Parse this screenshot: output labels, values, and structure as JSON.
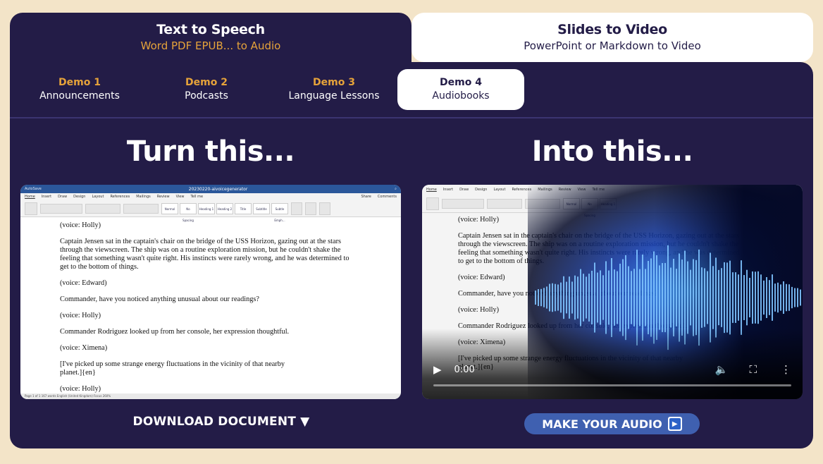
{
  "main_tabs": [
    {
      "title": "Text to Speech",
      "subtitle": "Word PDF EPUB... to Audio",
      "active": true
    },
    {
      "title": "Slides to Video",
      "subtitle": "PowerPoint or Markdown to Video",
      "active": false
    }
  ],
  "demo_tabs": [
    {
      "number": "Demo 1",
      "label": "Announcements"
    },
    {
      "number": "Demo 2",
      "label": "Podcasts"
    },
    {
      "number": "Demo 3",
      "label": "Language Lessons"
    },
    {
      "number": "Demo 4",
      "label": "Audiobooks",
      "active": true
    }
  ],
  "left_heading": "Turn this...",
  "right_heading": "Into this...",
  "word": {
    "filename": "20230220-aivoicegenerator",
    "autosave": "AutoSave",
    "menu": [
      "Home",
      "Insert",
      "Draw",
      "Design",
      "Layout",
      "References",
      "Mailings",
      "Review",
      "View",
      "Tell me"
    ],
    "share": "Share",
    "comments": "Comments",
    "styles": [
      "Normal",
      "No Spacing",
      "Heading 1",
      "Heading 2",
      "Title",
      "Subtitle",
      "Subtle Emph..."
    ],
    "status": "Page 1 of 1   167 words   English (United Kingdom)   Focus   260%"
  },
  "document": {
    "v1": "(voice: Holly)",
    "p1": "Captain Jensen sat in the captain's chair on the bridge of the USS Horizon, gazing out at the stars through the viewscreen. The ship was on a routine exploration mission, but he couldn't shake the feeling that something wasn't quite right. His instincts were rarely wrong, and he was determined to get to the bottom of things.",
    "v2": "(voice: Edward)",
    "p2": "Commander, have you noticed anything unusual about our readings?",
    "v3": "(voice: Holly)",
    "p3": "Commander Rodriguez looked up from her console, her expression thoughtful.",
    "v4": "(voice: Ximena)",
    "p4": "[I've picked up some strange energy fluctuations in the vicinity of that nearby planet.]{en}",
    "v5": "(voice: Holly)"
  },
  "video": {
    "time": "0:00",
    "progress_fraction": 0
  },
  "download_button": "DOWNLOAD DOCUMENT ▼",
  "make_audio_button": "MAKE YOUR AUDIO",
  "colors": {
    "navy": "#231c47",
    "accent": "#e6a33a",
    "background": "#f3e4c8",
    "button_blue": "#3f60b0"
  }
}
